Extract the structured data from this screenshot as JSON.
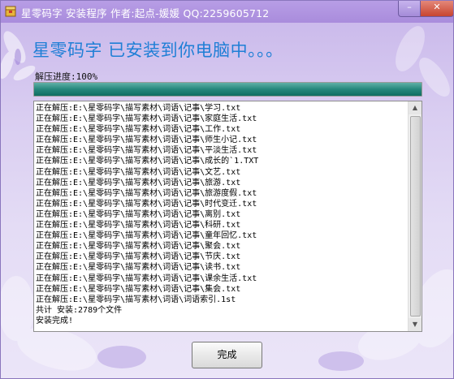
{
  "window": {
    "title": "星零码字 安装程序    作者:起点-媛媛    QQ:2259605712",
    "minimize_glyph": "–",
    "close_glyph": "✕"
  },
  "install": {
    "heading": "星零码字 已安装到你电脑中。。。",
    "progress_label": "解压进度:100%",
    "progress_value": 1.0,
    "log": [
      "正在解压:E:\\星零码字\\描写素材\\词语\\记事\\学习.txt",
      "正在解压:E:\\星零码字\\描写素材\\词语\\记事\\家庭生活.txt",
      "正在解压:E:\\星零码字\\描写素材\\词语\\记事\\工作.txt",
      "正在解压:E:\\星零码字\\描写素材\\词语\\记事\\师生小记.txt",
      "正在解压:E:\\星零码字\\描写素材\\词语\\记事\\平淡生活.txt",
      "正在解压:E:\\星零码字\\描写素材\\词语\\记事\\成长的`1.TXT",
      "正在解压:E:\\星零码字\\描写素材\\词语\\记事\\文艺.txt",
      "正在解压:E:\\星零码字\\描写素材\\词语\\记事\\旅游.txt",
      "正在解压:E:\\星零码字\\描写素材\\词语\\记事\\旅游度假.txt",
      "正在解压:E:\\星零码字\\描写素材\\词语\\记事\\时代变迁.txt",
      "正在解压:E:\\星零码字\\描写素材\\词语\\记事\\离别.txt",
      "正在解压:E:\\星零码字\\描写素材\\词语\\记事\\科研.txt",
      "正在解压:E:\\星零码字\\描写素材\\词语\\记事\\童年回忆.txt",
      "正在解压:E:\\星零码字\\描写素材\\词语\\记事\\聚会.txt",
      "正在解压:E:\\星零码字\\描写素材\\词语\\记事\\节庆.txt",
      "正在解压:E:\\星零码字\\描写素材\\词语\\记事\\读书.txt",
      "正在解压:E:\\星零码字\\描写素材\\词语\\记事\\课余生活.txt",
      "正在解压:E:\\星零码字\\描写素材\\词语\\记事\\集会.txt",
      "正在解压:E:\\星零码字\\描写素材\\词语\\词语索引.1st",
      "共计 安装:2789个文件",
      "安装完成!"
    ],
    "finish_label": "完成"
  },
  "colors": {
    "heading": "#1f7fd6",
    "progress": "#1a7a6f",
    "background": "#d9cdf1"
  },
  "icons": {
    "app": "app-box-icon",
    "scroll_up": "triangle-up",
    "scroll_down": "triangle-down"
  }
}
